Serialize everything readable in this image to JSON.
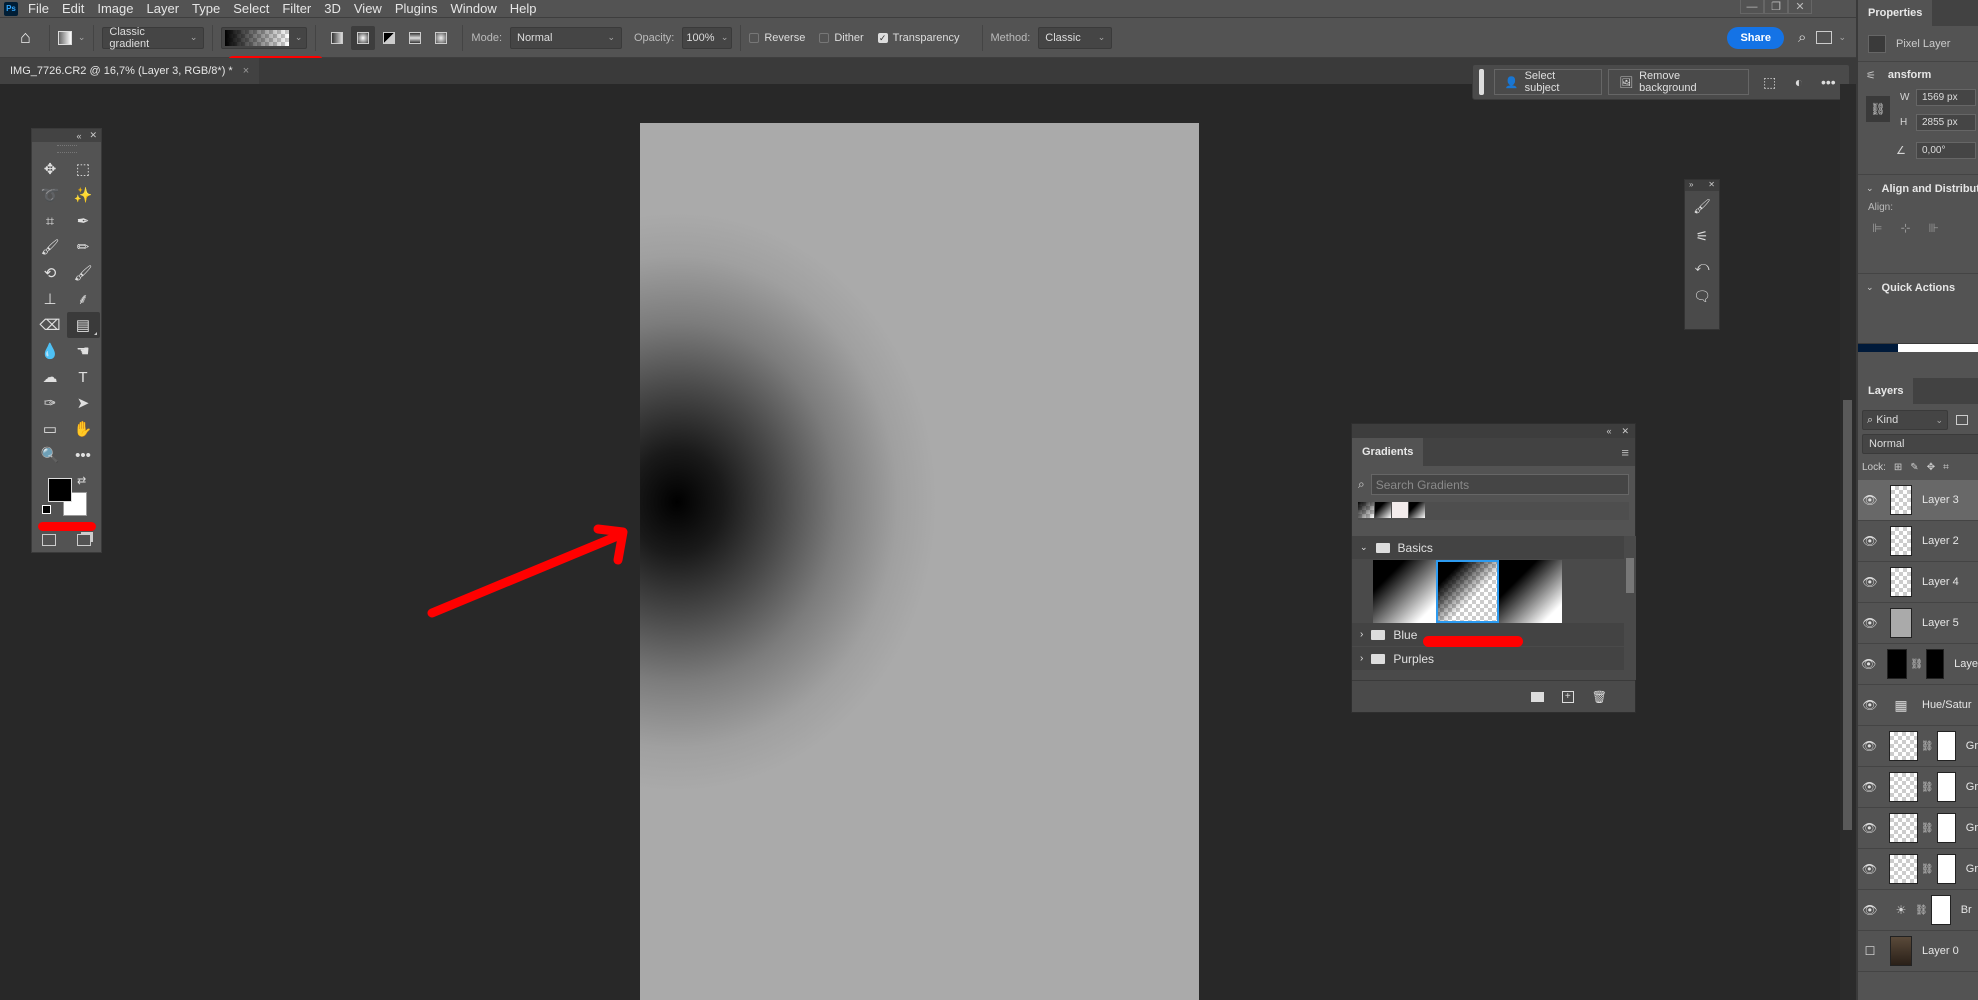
{
  "app": {
    "logo": "Ps"
  },
  "menubar": {
    "items": [
      "File",
      "Edit",
      "Image",
      "Layer",
      "Type",
      "Select",
      "Filter",
      "3D",
      "View",
      "Plugins",
      "Window",
      "Help"
    ]
  },
  "window_controls": {
    "minimize": "—",
    "restore": "❐",
    "close": "✕"
  },
  "options_bar": {
    "home_icon": "⌂",
    "gradient_type_preset": "Classic gradient",
    "gradient_styles": [
      "linear",
      "radial",
      "angle",
      "reflected",
      "diamond"
    ],
    "active_style": "radial",
    "mode_label": "Mode:",
    "mode_value": "Normal",
    "opacity_label": "Opacity:",
    "opacity_value": "100%",
    "reverse_label": "Reverse",
    "reverse_checked": false,
    "dither_label": "Dither",
    "dither_checked": false,
    "transparency_label": "Transparency",
    "transparency_checked": true,
    "method_label": "Method:",
    "method_value": "Classic",
    "share_label": "Share"
  },
  "document_tab": {
    "title": "IMG_7726.CR2 @ 16,7% (Layer 3, RGB/8*) *",
    "close": "×"
  },
  "contextual_taskbar": {
    "select_subject": "Select subject",
    "remove_background": "Remove background",
    "more": "•••"
  },
  "toolbox": {
    "tools": [
      {
        "name": "move-tool",
        "glyph": "✥"
      },
      {
        "name": "marquee-tool",
        "glyph": "⬚"
      },
      {
        "name": "lasso-tool",
        "glyph": "➰"
      },
      {
        "name": "magic-wand-tool",
        "glyph": "✨"
      },
      {
        "name": "crop-tool",
        "glyph": "⌗"
      },
      {
        "name": "eyedropper-tool",
        "glyph": "✒"
      },
      {
        "name": "brush-tool",
        "glyph": "🖌"
      },
      {
        "name": "pencil-tool",
        "glyph": "✏"
      },
      {
        "name": "history-brush-tool",
        "glyph": "⟲"
      },
      {
        "name": "mixer-brush-tool",
        "glyph": "🖌"
      },
      {
        "name": "clone-stamp-tool",
        "glyph": "⊥"
      },
      {
        "name": "art-history-brush-tool",
        "glyph": "⸙"
      },
      {
        "name": "eraser-tool",
        "glyph": "⌫"
      },
      {
        "name": "gradient-tool",
        "glyph": "▤"
      },
      {
        "name": "blur-tool",
        "glyph": "💧"
      },
      {
        "name": "smudge-tool",
        "glyph": "☚"
      },
      {
        "name": "sponge-tool",
        "glyph": "☁"
      },
      {
        "name": "type-tool",
        "glyph": "T"
      },
      {
        "name": "pen-tool",
        "glyph": "✑"
      },
      {
        "name": "path-selection-tool",
        "glyph": "➤"
      },
      {
        "name": "rectangle-tool",
        "glyph": "▭"
      },
      {
        "name": "hand-tool",
        "glyph": "✋"
      },
      {
        "name": "zoom-tool",
        "glyph": "🔍"
      },
      {
        "name": "more-tools",
        "glyph": "•••"
      }
    ],
    "active_tool": "gradient-tool",
    "foreground_color": "#000000",
    "background_color": "#ffffff"
  },
  "gradients_panel": {
    "title": "Gradients",
    "search_placeholder": "Search Gradients",
    "folders": [
      {
        "name": "Basics",
        "expanded": true
      },
      {
        "name": "Blue",
        "expanded": false
      },
      {
        "name": "Purples",
        "expanded": false
      }
    ],
    "basics_swatches": [
      "foreground-to-background",
      "foreground-to-transparent",
      "black-to-white"
    ],
    "selected_swatch": "foreground-to-transparent"
  },
  "properties_panel": {
    "title": "Properties",
    "layer_kind": "Pixel Layer",
    "transform_label": "ansform",
    "w_label": "W",
    "w_value": "1569 px",
    "h_label": "H",
    "h_value": "2855 px",
    "angle_value": "0,00°",
    "align_section": "Align and Distribute",
    "align_label": "Align:",
    "quick_actions": "Quick Actions"
  },
  "layers_panel": {
    "title": "Layers",
    "filter_kind": "Kind",
    "blend_mode": "Normal",
    "lock_label": "Lock:",
    "layers": [
      {
        "name": "Layer 3",
        "visible": true,
        "selected": true,
        "thumb": "transparent"
      },
      {
        "name": "Layer 2",
        "visible": true,
        "selected": false,
        "thumb": "transparent"
      },
      {
        "name": "Layer 4",
        "visible": true,
        "selected": false,
        "thumb": "transparent"
      },
      {
        "name": "Layer 5",
        "visible": true,
        "selected": false,
        "thumb": "gray"
      },
      {
        "name": "Laye",
        "visible": true,
        "selected": false,
        "thumb": "black-mask"
      },
      {
        "name": "Hue/Satur",
        "visible": true,
        "selected": false,
        "thumb": "adjustment"
      },
      {
        "name": "Gr",
        "visible": true,
        "selected": false,
        "thumb": "gradient-fill"
      },
      {
        "name": "Gr",
        "visible": true,
        "selected": false,
        "thumb": "gradient-fill"
      },
      {
        "name": "Gr",
        "visible": true,
        "selected": false,
        "thumb": "gradient-fill"
      },
      {
        "name": "Gr",
        "visible": true,
        "selected": false,
        "thumb": "gradient-fill"
      },
      {
        "name": "Br",
        "visible": true,
        "selected": false,
        "thumb": "brightness"
      },
      {
        "name": "Layer 0",
        "visible": false,
        "selected": false,
        "thumb": "photo"
      }
    ]
  },
  "colors": {
    "accent": "#1473e6",
    "selection": "#2d9bf0",
    "annotation": "#ff0000",
    "canvas": "#aaaaaa"
  }
}
